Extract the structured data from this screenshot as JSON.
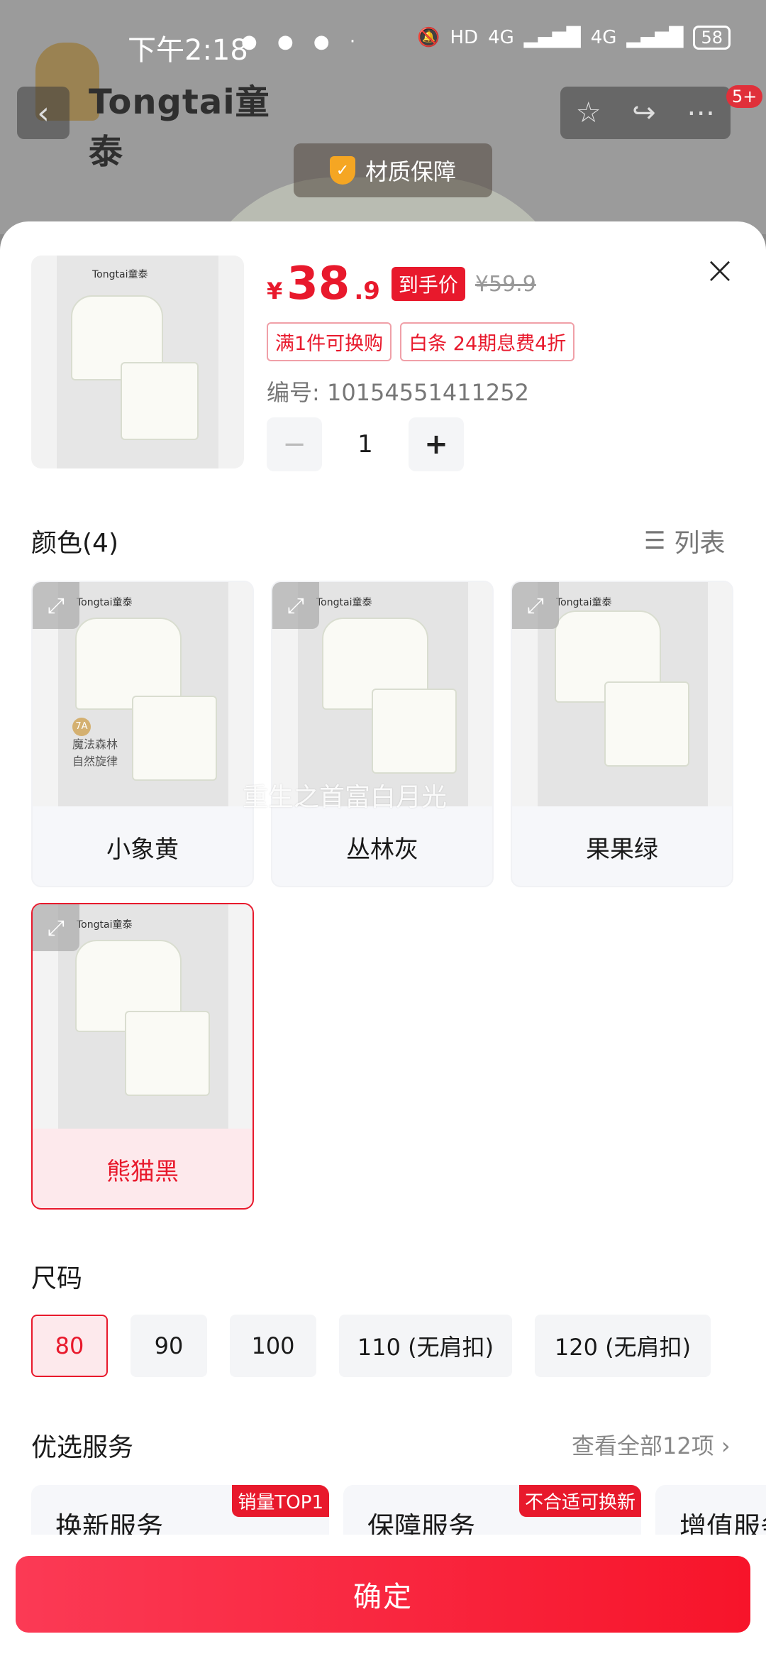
{
  "status_bar": {
    "time": "下午2:18",
    "notif_icons": "● ● ● ·",
    "hd": "HD",
    "net1": "4G",
    "net2": "4G",
    "battery": "58"
  },
  "background": {
    "brand": "Tongtai童泰",
    "quality_label": "材质保障",
    "more_badge": "5+"
  },
  "product": {
    "currency": "¥",
    "price_int": "38",
    "price_dec": ".9",
    "price_tag": "到手价",
    "orig_price": "¥59.9",
    "promos": [
      "满1件可换购",
      "白条 24期息费4折"
    ],
    "item_no": "编号: 10154551411252",
    "quantity": "1",
    "thumb_logo": "Tongtai童泰"
  },
  "colors": {
    "title": "颜色(4)",
    "list_label": "列表",
    "watermark": "重生之首富白月光",
    "items": [
      {
        "label": "小象黄",
        "sticker_badge": "7A",
        "sticker_line1": "魔法森林",
        "sticker_line2": "自然旋律"
      },
      {
        "label": "丛林灰"
      },
      {
        "label": "果果绿"
      },
      {
        "label": "熊猫黑"
      }
    ],
    "card_logo": "Tongtai童泰",
    "selected": "熊猫黑"
  },
  "sizes": {
    "title": "尺码",
    "items": [
      "80",
      "90",
      "100",
      "110 (无肩扣)",
      "120 (无肩扣)"
    ],
    "selected": "80"
  },
  "services": {
    "title": "优选服务",
    "see_all": "查看全部12项 ›",
    "items": [
      {
        "title": "换新服务",
        "badge": "销量TOP1"
      },
      {
        "title": "保障服务",
        "badge": "不合适可换新"
      },
      {
        "title": "增值服务",
        "badge": ""
      }
    ]
  },
  "confirm_label": "确定",
  "colors_theme": {
    "accent": "#e8192c",
    "selected_bg": "#fde9ec",
    "chip_bg": "#f4f5f7"
  }
}
